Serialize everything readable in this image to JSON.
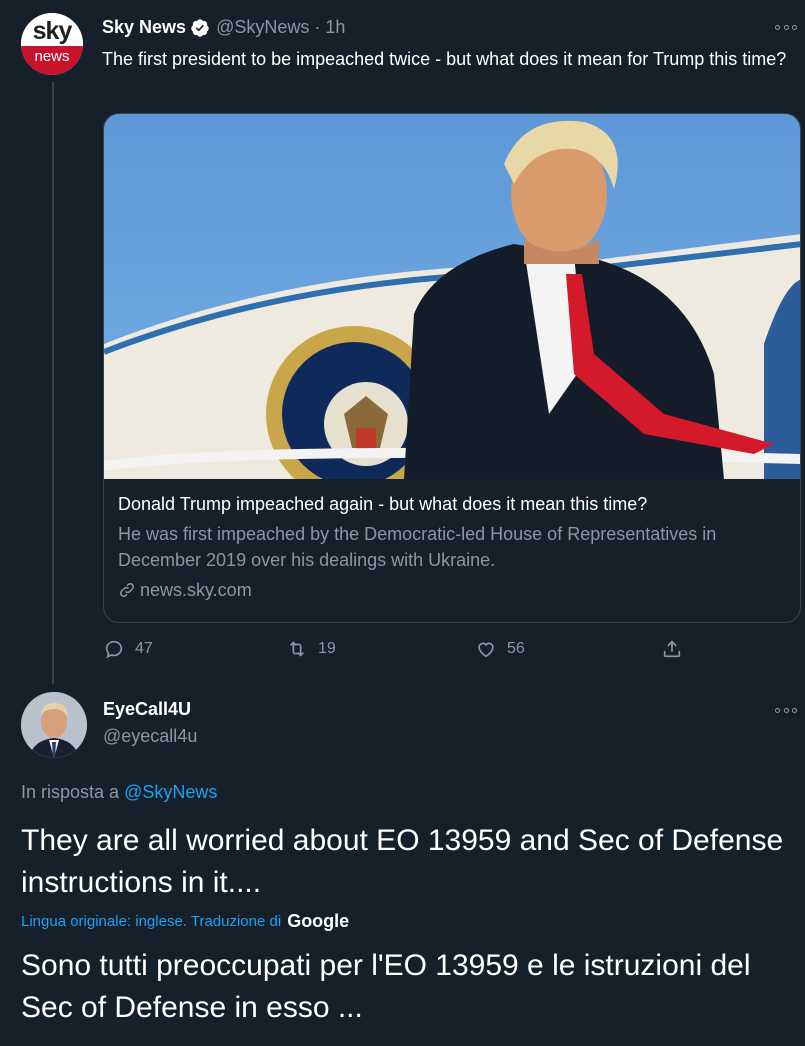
{
  "tweet": {
    "author_name": "Sky News",
    "author_handle": "@SkyNews",
    "separator": "·",
    "time": "1h",
    "avatar": {
      "top_text": "sky",
      "bottom_text": "news"
    },
    "text": "The first president to be impeached twice - but what does it mean for Trump this time?",
    "card": {
      "title": "Donald Trump impeached again - but what does it mean this time?",
      "description": "He was first impeached by the Democratic-led House of Representatives in December 2019 over his dealings with Ukraine.",
      "domain": "news.sky.com"
    },
    "actions": {
      "replies": "47",
      "retweets": "19",
      "likes": "56"
    }
  },
  "reply": {
    "author_name": "EyeCall4U",
    "author_handle": "@eyecall4u",
    "in_reply_prefix": "In risposta a",
    "in_reply_handle": "@SkyNews",
    "text": "They are all worried about EO 13959 and Sec of Defense instructions in it....",
    "translation_note": "Lingua originale: inglese. Traduzione di",
    "translation_provider": "Google",
    "translated_text": "Sono tutti preoccupati per l'EO 13959 e le istruzioni del Sec of Defense in esso ..."
  },
  "colors": {
    "background": "#15202b",
    "text": "#ffffff",
    "muted": "#8899a6",
    "accent": "#1da1f2",
    "border": "#38444d",
    "sky_red": "#c9132a"
  },
  "icons": [
    "verified-badge-icon",
    "more-options-icon",
    "reply-icon",
    "retweet-icon",
    "like-icon",
    "share-icon",
    "link-icon"
  ]
}
